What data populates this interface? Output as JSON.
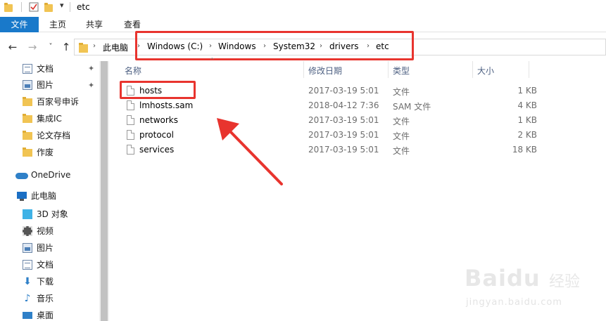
{
  "window": {
    "title": "etc"
  },
  "ribbon": {
    "tabs": [
      {
        "label": "文件",
        "active": true
      },
      {
        "label": "主页"
      },
      {
        "label": "共享"
      },
      {
        "label": "查看"
      }
    ]
  },
  "address": {
    "crumbs": [
      "此电脑",
      "Windows (C:)",
      "Windows",
      "System32",
      "drivers",
      "etc"
    ]
  },
  "sidebar": {
    "quick_access": [
      {
        "label": "文档",
        "icon": "document-icon",
        "pinned": true
      },
      {
        "label": "图片",
        "icon": "pictures-icon",
        "pinned": true
      },
      {
        "label": "百家号申诉",
        "icon": "folder-icon"
      },
      {
        "label": "集成IC",
        "icon": "folder-icon"
      },
      {
        "label": "论文存档",
        "icon": "folder-icon"
      },
      {
        "label": "作废",
        "icon": "folder-icon"
      }
    ],
    "onedrive": {
      "label": "OneDrive",
      "icon": "cloud-icon"
    },
    "this_pc": {
      "label": "此电脑",
      "icon": "computer-icon"
    },
    "pc_items": [
      {
        "label": "3D 对象",
        "icon": "3d-objects-icon"
      },
      {
        "label": "视频",
        "icon": "video-icon"
      },
      {
        "label": "图片",
        "icon": "pictures-icon"
      },
      {
        "label": "文档",
        "icon": "document-icon"
      },
      {
        "label": "下载",
        "icon": "download-icon"
      },
      {
        "label": "音乐",
        "icon": "music-icon"
      },
      {
        "label": "桌面",
        "icon": "desktop-icon"
      }
    ]
  },
  "list": {
    "columns": {
      "name": "名称",
      "date": "修改日期",
      "type": "类型",
      "size": "大小"
    },
    "files": [
      {
        "name": "hosts",
        "date": "2017-03-19 5:01",
        "type": "文件",
        "size": "1 KB"
      },
      {
        "name": "lmhosts.sam",
        "date": "2018-04-12 7:36",
        "type": "SAM 文件",
        "size": "4 KB"
      },
      {
        "name": "networks",
        "date": "2017-03-19 5:01",
        "type": "文件",
        "size": "1 KB"
      },
      {
        "name": "protocol",
        "date": "2017-03-19 5:01",
        "type": "文件",
        "size": "2 KB"
      },
      {
        "name": "services",
        "date": "2017-03-19 5:01",
        "type": "文件",
        "size": "18 KB"
      }
    ]
  },
  "watermark": {
    "brand": "Baidu",
    "suffix": "经验",
    "url": "jingyan.baidu.com"
  },
  "colors": {
    "accent": "#1979ca",
    "highlight": "#e8342e",
    "folder": "#f1c453"
  }
}
